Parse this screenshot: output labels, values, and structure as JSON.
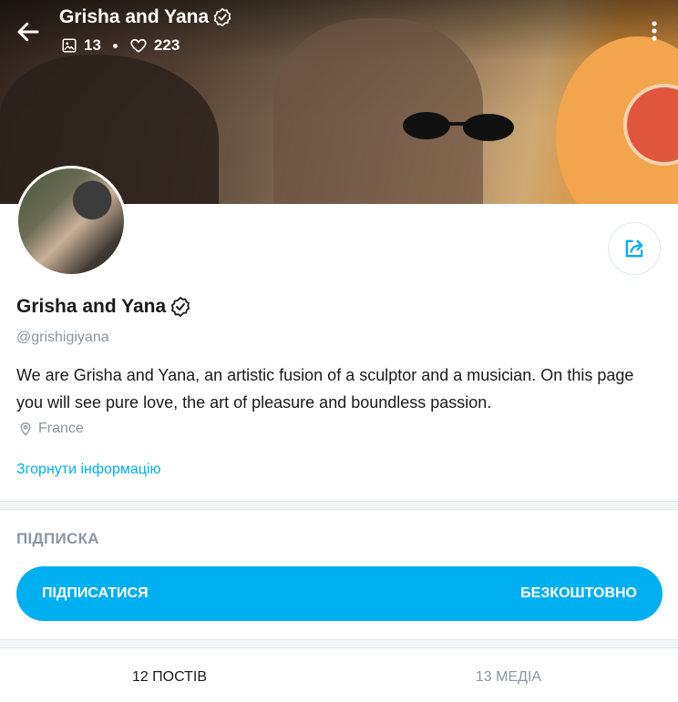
{
  "header": {
    "title": "Grisha and Yana",
    "media_count": "13",
    "likes_count": "223"
  },
  "profile": {
    "name": "Grisha and Yana",
    "handle": "@grishigiyana",
    "bio": "We are Grisha and Yana, an artistic fusion of a sculptor and a musician. On this page you will see pure love, the art of pleasure and boundless passion.",
    "location": "France",
    "collapse_label": "Згорнути інформацію"
  },
  "subscription": {
    "section_title": "ПІДПИСКА",
    "button_label": "ПІДПИСАТИСЯ",
    "price_label": "БЕЗКОШТОВНО"
  },
  "tabs": [
    {
      "label": "12 ПОСТІВ"
    },
    {
      "label": "13 МЕДІА"
    }
  ],
  "icons": {
    "back": "arrow-left-icon",
    "verified": "verified-badge-icon",
    "media": "image-icon",
    "likes": "heart-icon",
    "more": "more-vertical-icon",
    "share": "share-icon",
    "location": "location-pin-icon"
  },
  "colors": {
    "accent": "#00aff0",
    "muted": "#8a96a3",
    "text": "#1a1a1a"
  }
}
